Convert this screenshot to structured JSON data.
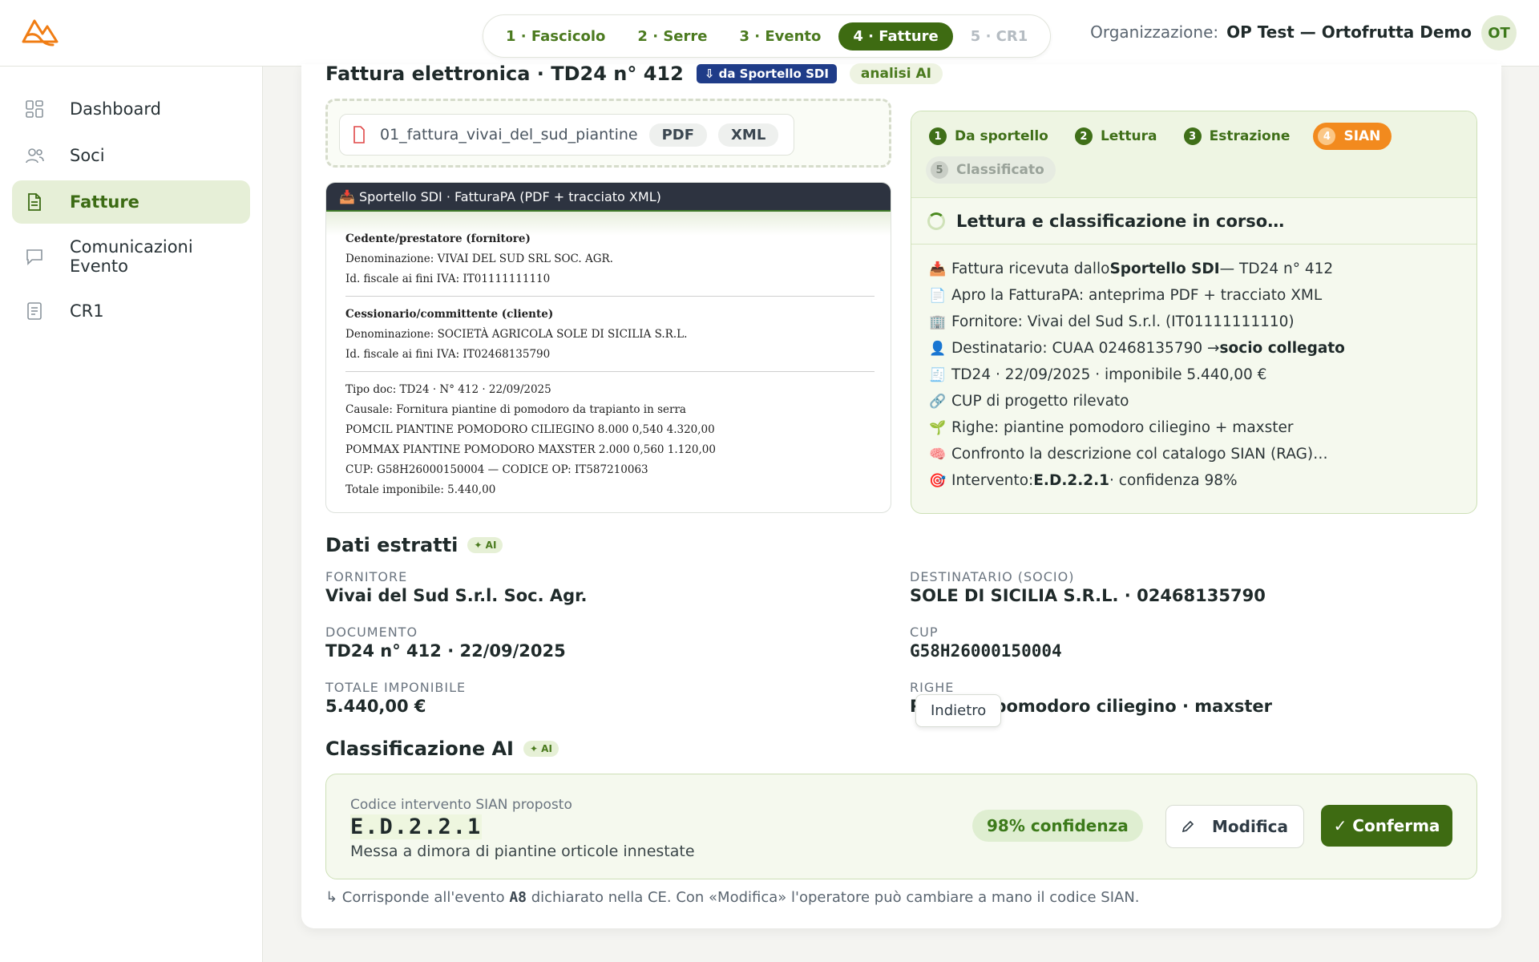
{
  "stepper": [
    {
      "label": "1 · Fascicolo",
      "state": "done"
    },
    {
      "label": "2 · Serre",
      "state": "done"
    },
    {
      "label": "3 · Evento",
      "state": "done"
    },
    {
      "label": "4 · Fatture",
      "state": "active"
    },
    {
      "label": "5 · CR1",
      "state": "disabled"
    }
  ],
  "org": {
    "label": "Organizzazione:",
    "name": "OP Test — Ortofrutta Demo",
    "avatar": "OT"
  },
  "sidebar": {
    "items": [
      {
        "label": "Dashboard",
        "icon": "grid-icon"
      },
      {
        "label": "Soci",
        "icon": "users-icon"
      },
      {
        "label": "Fatture",
        "icon": "document-icon",
        "active": true
      },
      {
        "label": "Comunicazioni Evento",
        "icon": "chat-icon"
      },
      {
        "label": "CR1",
        "icon": "list-icon"
      }
    ]
  },
  "invoice": {
    "title": "Fattura elettronica · TD24 n° 412",
    "source_badge": "⇩ da Sportello SDI",
    "ai_badge": "analisi AI",
    "file_name": "01_fattura_vivai_del_sud_piantine",
    "tags": [
      "PDF",
      "XML"
    ]
  },
  "pdf_preview": {
    "header": "📥 Sportello SDI · FatturaPA (PDF + tracciato XML)",
    "cedente_title": "Cedente/prestatore (fornitore)",
    "cedente_name": "Denominazione: VIVAI DEL SUD SRL SOC. AGR.",
    "cedente_vat": "Id. fiscale ai fini IVA: IT01111111110",
    "cessionario_title": "Cessionario/committente (cliente)",
    "cessionario_name": "Denominazione: SOCIETÀ AGRICOLA SOLE DI SICILIA S.R.L.",
    "cessionario_vat": "Id. fiscale ai fini IVA: IT02468135790",
    "lines": [
      "Tipo doc: TD24 · N° 412 · 22/09/2025",
      "Causale: Fornitura piantine di pomodoro da trapianto in serra",
      "POMCIL PIANTINE POMODORO CILIEGINO 8.000 0,540 4.320,00",
      "POMMAX PIANTINE POMODORO MAXSTER 2.000 0,560 1.120,00",
      "CUP: G58H26000150004 — CODICE OP: IT587210063",
      "Totale imponibile: 5.440,00"
    ]
  },
  "processing": {
    "phases": [
      {
        "num": "1",
        "label": "Da sportello",
        "state": "done"
      },
      {
        "num": "2",
        "label": "Lettura",
        "state": "done"
      },
      {
        "num": "3",
        "label": "Estrazione",
        "state": "done"
      },
      {
        "num": "4",
        "label": "SIAN",
        "state": "current"
      },
      {
        "num": "5",
        "label": "Classificato",
        "state": "pending"
      }
    ],
    "status": "Lettura e classificazione in corso…",
    "log": [
      {
        "icon": "📥",
        "pre": "Fattura ricevuta dallo ",
        "bold": "Sportello SDI",
        "post": " — TD24 n° 412"
      },
      {
        "icon": "📄",
        "pre": "Apro la FatturaPA: anteprima PDF + tracciato XML",
        "bold": "",
        "post": ""
      },
      {
        "icon": "🏢",
        "pre": "Fornitore: Vivai del Sud S.r.l. (IT01111111110)",
        "bold": "",
        "post": ""
      },
      {
        "icon": "👤",
        "pre": "Destinatario: CUAA 02468135790 → ",
        "bold": "socio collegato",
        "post": ""
      },
      {
        "icon": "🧾",
        "pre": "TD24 · 22/09/2025 · imponibile 5.440,00 €",
        "bold": "",
        "post": ""
      },
      {
        "icon": "🔗",
        "pre": "CUP di progetto rilevato",
        "bold": "",
        "post": ""
      },
      {
        "icon": "🌱",
        "pre": "Righe: piantine pomodoro ciliegino + maxster",
        "bold": "",
        "post": ""
      },
      {
        "icon": "🧠",
        "pre": "Confronto la descrizione col catalogo SIAN (RAG)…",
        "bold": "",
        "post": ""
      },
      {
        "icon": "🎯",
        "pre": "Intervento: ",
        "bold": "E.D.2.2.1",
        "post": " · confidenza 98%"
      }
    ]
  },
  "extracted": {
    "title": "Dati estratti",
    "ai_tag": "✦ AI",
    "fields": [
      {
        "label": "FORNITORE",
        "value": "Vivai del Sud S.r.l. Soc. Agr."
      },
      {
        "label": "DESTINATARIO (SOCIO)",
        "value": "SOLE DI SICILIA S.R.L. · 02468135790"
      },
      {
        "label": "DOCUMENTO",
        "value": "TD24 n° 412 · 22/09/2025"
      },
      {
        "label": "CUP",
        "value": "G58H26000150004"
      },
      {
        "label": "TOTALE IMPONIBILE",
        "value": "5.440,00 €"
      },
      {
        "label": "RIGHE",
        "value": "Piantine pomodoro ciliegino · maxster"
      }
    ],
    "tooltip": "Indietro"
  },
  "classification": {
    "title": "Classificazione AI",
    "ai_tag": "✦ AI",
    "proposed_label": "Codice intervento SIAN proposto",
    "code": "E.D.2.2.1",
    "description": "Messa a dimora di piantine orticole innestate",
    "confidence": "98% confidenza",
    "modify_label": "Modifica",
    "confirm_label": "✓ Conferma",
    "note_pre": "↳ Corrisponde all'evento ",
    "note_code": "A8",
    "note_post": " dichiarato nella CE. Con «Modifica» l'operatore può cambiare a mano il codice SIAN."
  }
}
